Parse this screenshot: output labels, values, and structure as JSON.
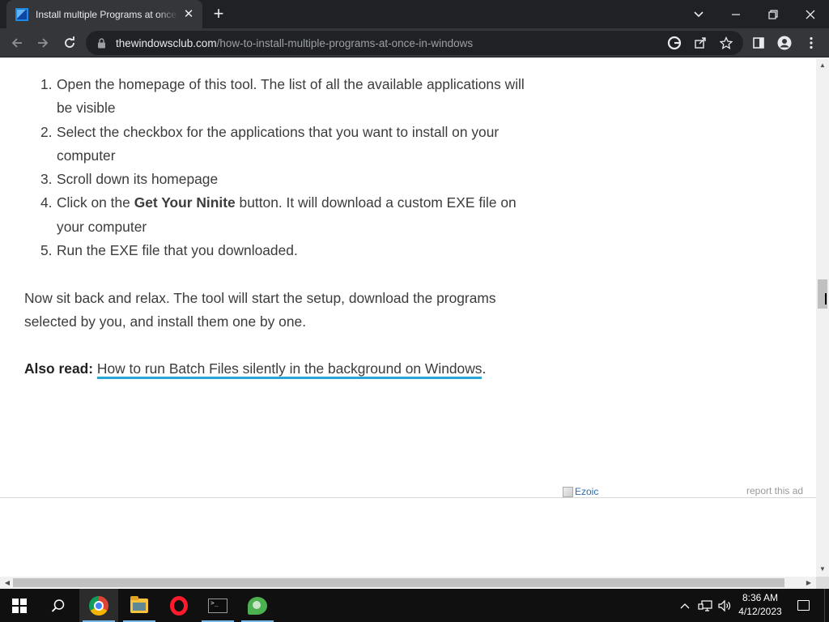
{
  "browser": {
    "tab": {
      "title": "Install multiple Programs at once in Windows",
      "close": "✕"
    },
    "new_tab": "+",
    "window_controls": {
      "tabsearch": "⌄",
      "minimize": "—",
      "restore": "❐",
      "close": "✕"
    },
    "toolbar": {
      "back": "←",
      "forward": "→",
      "reload": "↻"
    },
    "omnibox": {
      "host": "thewindowsclub.com",
      "path": "/how-to-install-multiple-programs-at-once-in-windows"
    }
  },
  "article": {
    "steps": [
      {
        "num": "1.",
        "text": "Open the homepage of this tool. The list of all the available applications will be visible"
      },
      {
        "num": "2.",
        "text": "Select the checkbox for the applications that you want to install on your computer"
      },
      {
        "num": "3.",
        "text": "Scroll down its homepage"
      },
      {
        "num": "4.",
        "pre": "Click on the ",
        "bold": "Get Your Ninite",
        "post": " button. It will download a custom EXE file on your computer"
      },
      {
        "num": "5.",
        "text": "Run the EXE file that you downloaded."
      }
    ],
    "paragraph": "Now sit back and relax. The tool will start the setup, download the programs selected by you, and install them one by one.",
    "also_read": {
      "label": "Also read:",
      "link_text": "How to run Batch Files silently in the background on Windows",
      "trailing": "."
    },
    "ad": {
      "image_alt": "Ezoic",
      "report": "report this ad"
    }
  },
  "taskbar": {
    "clock": {
      "time": "8:36 AM",
      "date": "4/12/2023"
    },
    "tray": {
      "chevron": "^"
    }
  },
  "colors": {
    "link_underline": "#2aa6d8",
    "chrome_dark": "#202124",
    "chrome_toolbar": "#35363a"
  },
  "scroll": {
    "vertical_position_fraction": 0.44
  }
}
